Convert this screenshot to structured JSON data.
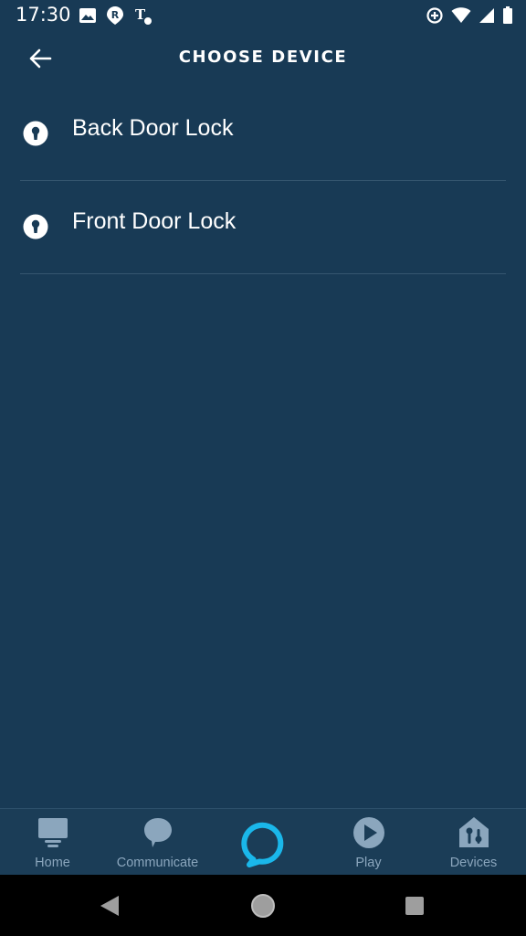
{
  "status_bar": {
    "time": "17:30",
    "icons": [
      "image-icon",
      "r-badge-icon",
      "t-mobile-icon",
      "data-saver-icon",
      "wifi-icon",
      "signal-icon",
      "battery-icon"
    ]
  },
  "header": {
    "title": "CHOOSE DEVICE",
    "back_icon": "arrow-left-icon"
  },
  "devices": [
    {
      "label": "Back Door Lock",
      "icon": "lock-icon"
    },
    {
      "label": "Front Door Lock",
      "icon": "lock-icon"
    }
  ],
  "bottom_nav": {
    "items": [
      {
        "label": "Home",
        "icon": "home-icon"
      },
      {
        "label": "Communicate",
        "icon": "chat-bubble-icon"
      },
      {
        "label": "",
        "icon": "alexa-ring-icon"
      },
      {
        "label": "Play",
        "icon": "play-icon"
      },
      {
        "label": "Devices",
        "icon": "devices-house-icon"
      }
    ]
  },
  "system_nav": {
    "buttons": [
      "back-triangle-icon",
      "home-circle-icon",
      "recents-square-icon"
    ]
  },
  "colors": {
    "background": "#183a55",
    "nav_background": "#1b3d57",
    "divider": "#35566f",
    "nav_label": "#8ba6bd",
    "alexa_accent": "#1ab7ea"
  }
}
